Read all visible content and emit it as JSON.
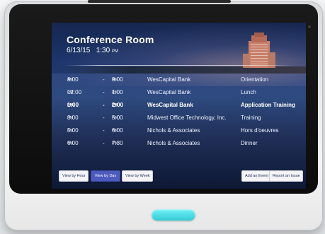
{
  "room": {
    "title": "Conference Room",
    "date": "6/13/15",
    "time": "1:30",
    "time_suffix": "PM"
  },
  "events": [
    {
      "start": "8:00",
      "start_ampm": "AM",
      "end": "9:00",
      "end_ampm": "AM",
      "organizer": "WesCapital Bank",
      "type": "Orientation",
      "active": false
    },
    {
      "start": "12:00",
      "start_ampm": "PM",
      "end": "1:00",
      "end_ampm": "PM",
      "organizer": "WesCapital Bank",
      "type": "Lunch",
      "active": false
    },
    {
      "start": "1:00",
      "start_ampm": "PM",
      "end": "2:00",
      "end_ampm": "PM",
      "organizer": "WesCapital Bank",
      "type": "Application Training",
      "active": true
    },
    {
      "start": "3:00",
      "start_ampm": "PM",
      "end": "5:00",
      "end_ampm": "PM",
      "organizer": "Midwest Office Technology, Inc.",
      "type": "Training",
      "active": false
    },
    {
      "start": "5:00",
      "start_ampm": "PM",
      "end": "6:00",
      "end_ampm": "PM",
      "organizer": "Nichols & Associates",
      "type": "Hors d'oeuvres",
      "active": false
    },
    {
      "start": "6:00",
      "start_ampm": "PM",
      "end": "7:30",
      "end_ampm": "PM",
      "organizer": "Nichols & Associates",
      "type": "Dinner",
      "active": false
    }
  ],
  "dash": "-",
  "buttons": {
    "view_by_hour": "View by Hour",
    "view_by_day": "View by Day",
    "view_by_week": "View by Week",
    "add_event": "Add an Event",
    "report_issue": "Report an Issue"
  },
  "colors": {
    "accent": "#4d5bbd",
    "home_button": "#35cbd6"
  }
}
